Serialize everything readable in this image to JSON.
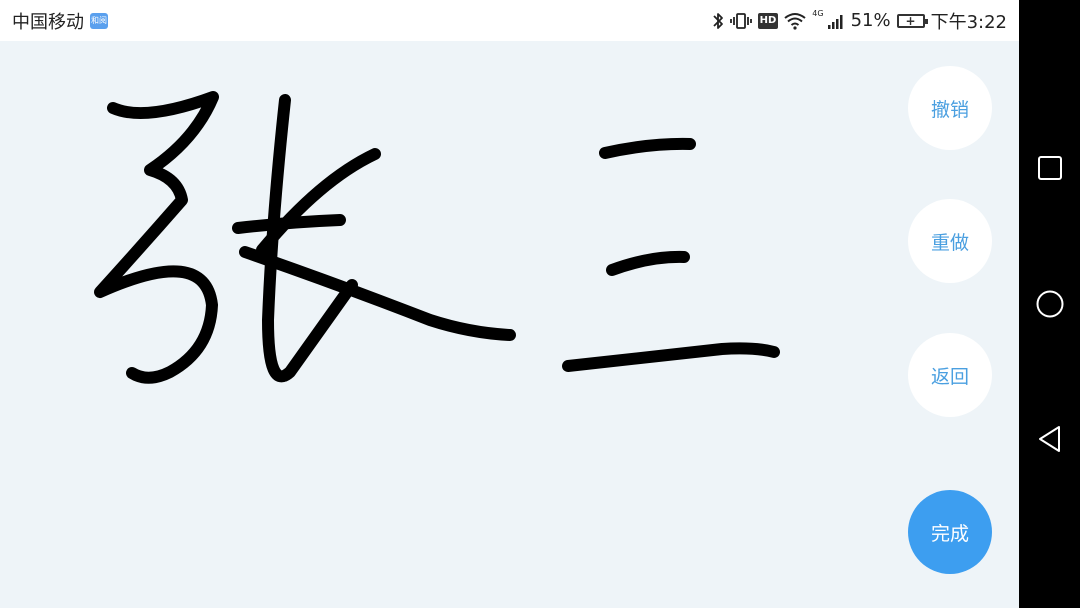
{
  "status": {
    "carrier": "中国移动",
    "carrier_badge": "和阅",
    "hd": "HD",
    "network": "4G",
    "battery_percent": "51%",
    "time": "下午3:22"
  },
  "actions": {
    "undo": "撤销",
    "redo": "重做",
    "back": "返回",
    "done": "完成"
  },
  "colors": {
    "canvas_bg": "#eef4f8",
    "accent": "#3d9ef0",
    "ink": "#000000"
  },
  "navbar": {
    "icons": [
      "square-icon",
      "circle-icon",
      "triangle-back-icon"
    ]
  }
}
